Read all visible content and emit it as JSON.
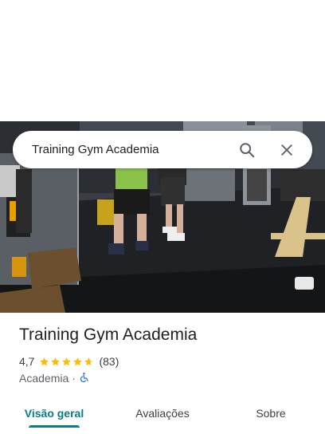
{
  "search": {
    "query": "Training Gym Academia",
    "search_icon": "search-icon",
    "close_icon": "close-icon"
  },
  "place": {
    "name": "Training Gym Academia",
    "rating": "4,7",
    "rating_value": 4.7,
    "rating_max": 5,
    "reviews": "(83)",
    "category": "Academia",
    "separator": "·",
    "accessibility_icon": "wheelchair-icon"
  },
  "tabs": [
    {
      "label": "Visão geral",
      "active": true
    },
    {
      "label": "Avaliações",
      "active": false
    },
    {
      "label": "Sobre",
      "active": false
    }
  ],
  "colors": {
    "accent": "#0b7c87",
    "star": "#fbbc04",
    "accessibility": "#1a73e8"
  }
}
